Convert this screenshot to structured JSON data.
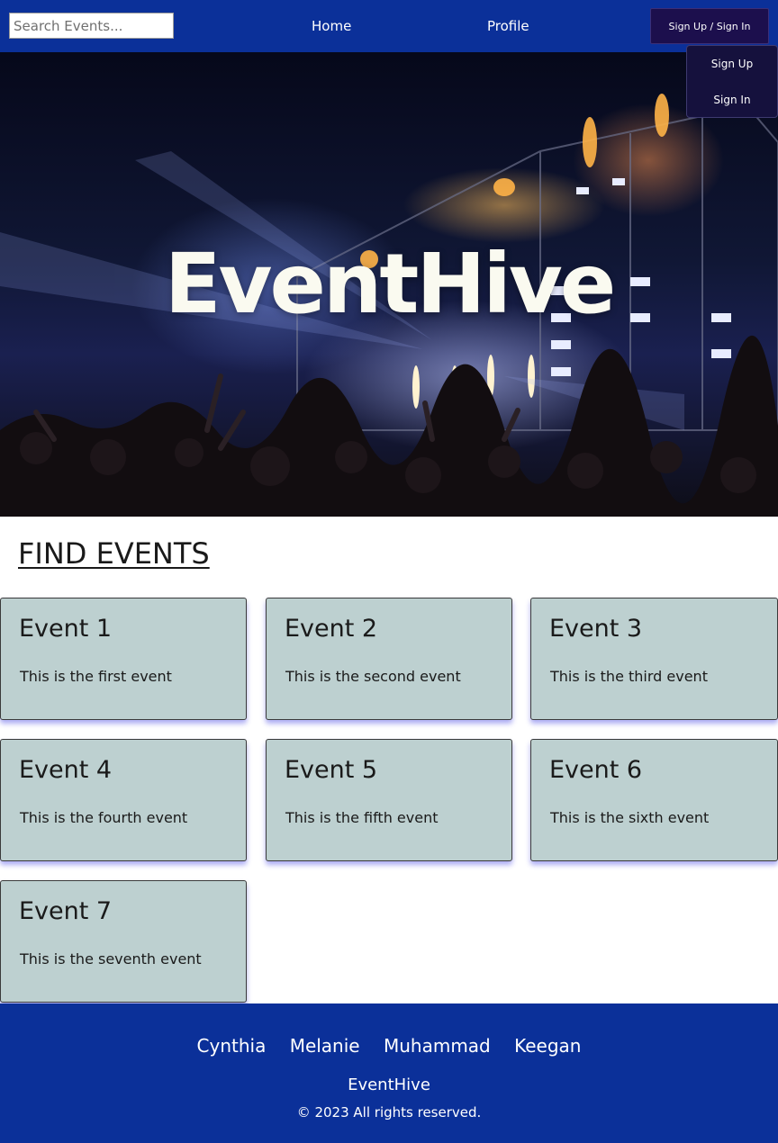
{
  "navbar": {
    "search_placeholder": "Search Events...",
    "links": {
      "home": "Home",
      "profile": "Profile"
    },
    "auth_button": "Sign Up / Sign In",
    "dropdown": {
      "sign_up": "Sign Up",
      "sign_in": "Sign In"
    }
  },
  "hero": {
    "title": "EventHive"
  },
  "events_section": {
    "heading": "FIND EVENTS",
    "events": [
      {
        "title": "Event 1",
        "description": "This is the first event"
      },
      {
        "title": "Event 2",
        "description": "This is the second event"
      },
      {
        "title": "Event 3",
        "description": "This is the third event"
      },
      {
        "title": "Event 4",
        "description": "This is the fourth event"
      },
      {
        "title": "Event 5",
        "description": "This is the fifth event"
      },
      {
        "title": "Event 6",
        "description": "This is the sixth event"
      },
      {
        "title": "Event 7",
        "description": "This is the seventh event"
      }
    ]
  },
  "footer": {
    "names": [
      "Cynthia",
      "Melanie",
      "Muhammad",
      "Keegan"
    ],
    "brand": "EventHive",
    "copyright": "© 2023 All rights reserved."
  },
  "colors": {
    "nav_background": "#0b3099",
    "auth_button": "#1c0f4d",
    "card_background": "#bdd0d0",
    "card_shadow": "#4646e6"
  }
}
